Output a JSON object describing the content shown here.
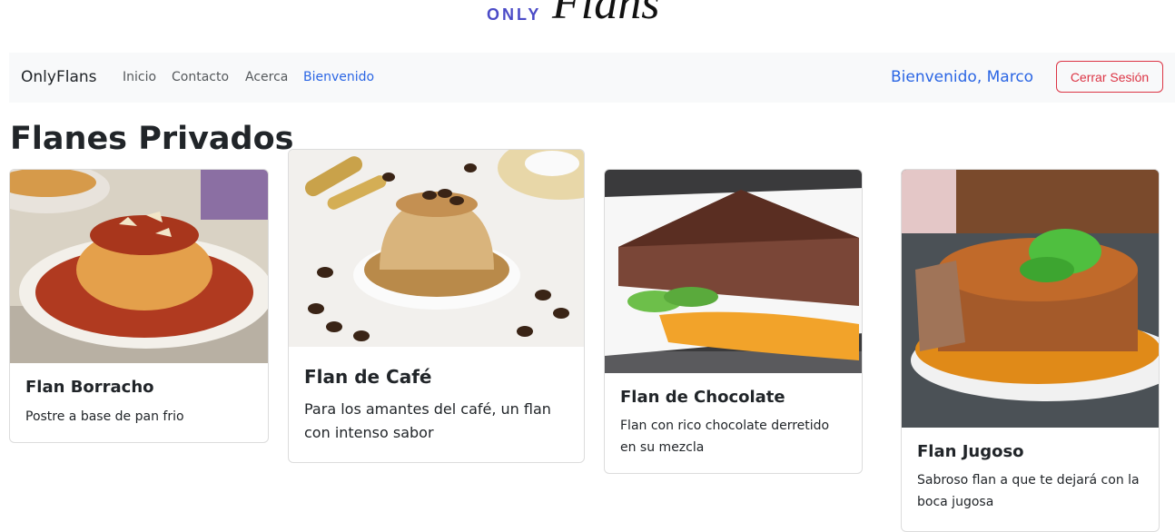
{
  "logo": {
    "only": "ONLY",
    "flans": "Flans"
  },
  "navbar": {
    "brand": "OnlyFlans",
    "links": [
      "Inicio",
      "Contacto",
      "Acerca",
      "Bienvenido"
    ],
    "welcome": "Bienvenido, Marco",
    "logout": "Cerrar Sesión"
  },
  "page_title": "Flanes Privados",
  "cards": [
    {
      "title": "Flan Borracho",
      "text": "Postre a base de pan frio"
    },
    {
      "title": "Flan de Café",
      "text": "Para los amantes del café, un flan con intenso sabor"
    },
    {
      "title": "Flan de Chocolate",
      "text": "Flan con rico chocolate derretido en su mezcla"
    },
    {
      "title": "Flan Jugoso",
      "text": "Sabroso flan a que te dejará con la boca jugosa"
    }
  ],
  "colors": {
    "accent": "#2b66e4",
    "danger": "#dc3545",
    "navbar_bg": "#f8f9fa"
  }
}
